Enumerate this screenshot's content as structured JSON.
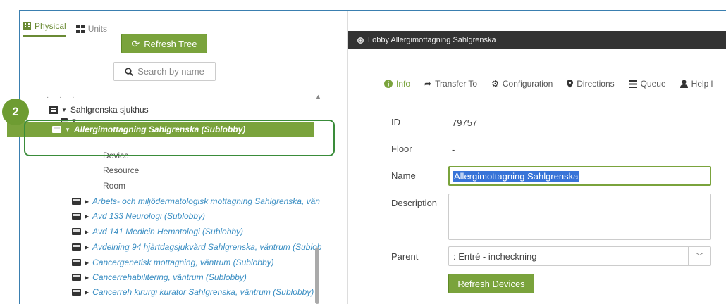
{
  "left_panel": {
    "tabs": [
      {
        "label": "Physical",
        "icon": "building-icon",
        "active": true
      },
      {
        "label": "Units",
        "icon": "grid-icon",
        "active": false
      }
    ],
    "refresh_tree_label": "Refresh Tree",
    "search_placeholder": "Search by name",
    "tree": {
      "root_label": "Sahlgrenska sjukhus",
      "selected_label": "Allergimottagning Sahlgrenska (Sublobby)",
      "children": [
        "Device",
        "Resource",
        "Room"
      ],
      "items": [
        "Arbets- och miljödermatologisk mottagning Sahlgrenska, vän",
        "Avd 133 Neurologi (Sublobby)",
        "Avd 141 Medicin Hematologi (Sublobby)",
        "Avdelning 94 hjärtdagsjukvård Sahlgrenska, väntrum (Sublob",
        "Cancergenetisk mottagning, väntrum (Sublobby)",
        "Cancerrehabilitering, väntrum (Sublobby)",
        "Cancerreh kirurgi kurator Sahlgrenska, väntrum (Sublobby)"
      ]
    },
    "step_badge": "2"
  },
  "right_panel": {
    "header_title": "Lobby Allergimottagning Sahlgrenska",
    "tabs": [
      {
        "label": "Info",
        "icon": "info-icon",
        "active": true
      },
      {
        "label": "Transfer To",
        "icon": "share-arrow-icon",
        "active": false
      },
      {
        "label": "Configuration",
        "icon": "gears-icon",
        "active": false
      },
      {
        "label": "Directions",
        "icon": "map-marker-icon",
        "active": false
      },
      {
        "label": "Queue",
        "icon": "list-icon",
        "active": false
      },
      {
        "label": "Help l",
        "icon": "user-icon",
        "active": false
      }
    ],
    "form": {
      "id_label": "ID",
      "id_value": "79757",
      "floor_label": "Floor",
      "floor_value": "-",
      "name_label": "Name",
      "name_value": "Allergimottagning Sahlgrenska",
      "description_label": "Description",
      "parent_label": "Parent",
      "parent_value": ": Entré - incheckning",
      "refresh_devices_label": "Refresh Devices"
    }
  },
  "colors": {
    "accent_green": "#7aa33c",
    "link_blue": "#3a8ec3",
    "header_dark": "#333333",
    "highlight_outline": "#3a8c3a"
  }
}
